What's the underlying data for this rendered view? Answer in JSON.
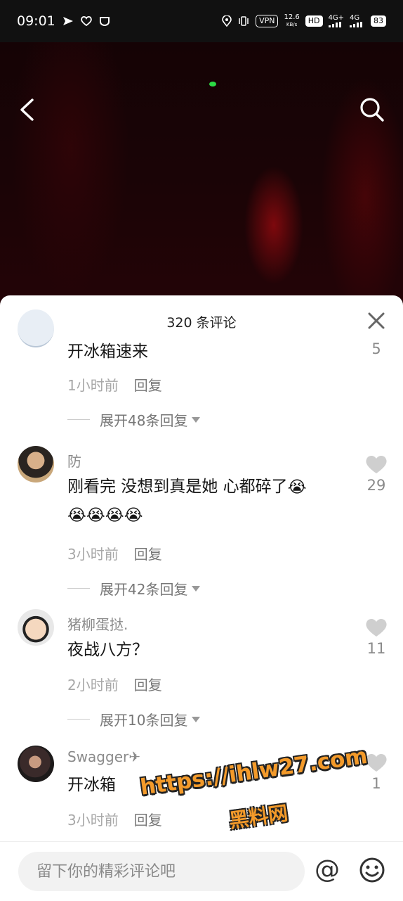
{
  "status_bar": {
    "time": "09:01",
    "vpn": "VPN",
    "net_speed_value": "12.6",
    "net_speed_unit": "KB/s",
    "hd": "HD",
    "signal1": "4G+",
    "signal2": "4G",
    "battery": "83"
  },
  "header": {
    "back_icon": "chevron-left-icon",
    "search_icon": "search-icon"
  },
  "comments_panel": {
    "title": "320 条评论",
    "close_icon": "close-icon",
    "comments": [
      {
        "username": "",
        "text": "开冰箱速来",
        "time": "1小时前",
        "reply_label": "回复",
        "expand_label": "展开48条回复",
        "like_count": "5"
      },
      {
        "username": "防",
        "text": "刚看完 没想到真是她 心都碎了",
        "emojis": [
          "😭",
          "😭",
          "😭",
          "😭",
          "😭"
        ],
        "time": "3小时前",
        "reply_label": "回复",
        "expand_label": "展开42条回复",
        "like_count": "29"
      },
      {
        "username": "猪柳蛋挞.",
        "text": "夜战八方？",
        "time": "2小时前",
        "reply_label": "回复",
        "expand_label": "展开10条回复",
        "like_count": "11"
      },
      {
        "username": "Swagger✈",
        "text": "开冰箱",
        "time": "3小时前",
        "reply_label": "回复",
        "like_count": "1"
      }
    ]
  },
  "input_bar": {
    "placeholder": "留下你的精彩评论吧",
    "at_label": "@",
    "emoji_icon": "smiley-icon"
  },
  "watermark": {
    "url": "https://ihlw27.com",
    "name": "黑料网"
  },
  "colors": {
    "accent_like": "#cfcfcf",
    "watermark": "#f39a2a"
  }
}
